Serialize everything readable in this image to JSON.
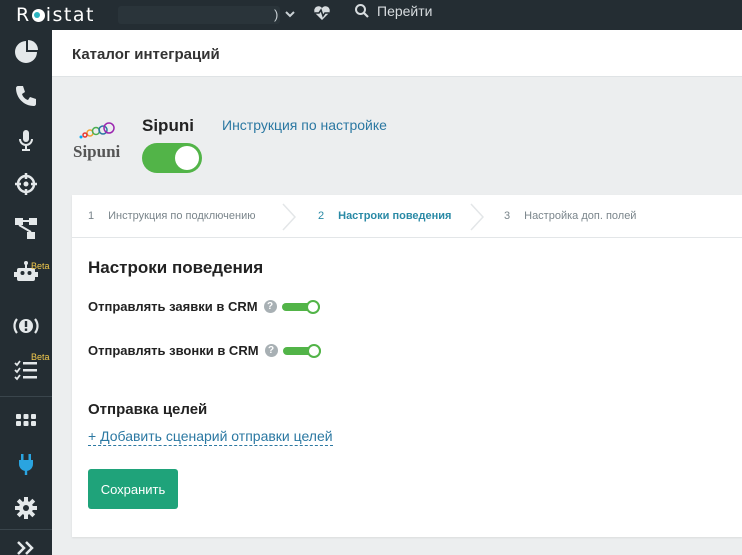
{
  "topbar": {
    "logo": "Roistat",
    "project_name": ")",
    "goto_label": "Перейти"
  },
  "sidebar": {
    "items": [
      {
        "name": "analytics",
        "icon": "pie-chart-icon"
      },
      {
        "name": "calltracking",
        "icon": "phone-icon"
      },
      {
        "name": "speech",
        "icon": "microphone-icon"
      },
      {
        "name": "targeting",
        "icon": "crosshair-icon"
      },
      {
        "name": "leads",
        "icon": "flow-icon"
      },
      {
        "name": "bot",
        "icon": "robot-icon",
        "badge": "Beta"
      },
      {
        "name": "alerts",
        "icon": "alert-icon"
      },
      {
        "name": "tasks",
        "icon": "checklist-icon",
        "badge": "Beta"
      },
      {
        "name": "apps",
        "icon": "grid-icon"
      },
      {
        "name": "integrations",
        "icon": "plug-icon"
      },
      {
        "name": "settings",
        "icon": "gear-icon"
      },
      {
        "name": "expand",
        "icon": "double-chevron-icon"
      }
    ]
  },
  "page": {
    "title": "Каталог интеграций"
  },
  "integration": {
    "name": "Sipuni",
    "logo_text": "Sipuni",
    "enabled": true,
    "instruction_link": "Инструкция по настройке"
  },
  "steps": [
    {
      "num": "1",
      "label": "Инструкция по подключению",
      "active": false
    },
    {
      "num": "2",
      "label": "Настроки поведения",
      "active": true
    },
    {
      "num": "3",
      "label": "Настройка доп. полей",
      "active": false
    }
  ],
  "settings": {
    "section_title": "Настроки поведения",
    "options": [
      {
        "label": "Отправлять заявки в CRM",
        "enabled": true
      },
      {
        "label": "Отправлять звонки в CRM",
        "enabled": true
      }
    ],
    "help_glyph": "?"
  },
  "goals": {
    "title": "Отправка целей",
    "add_link": "+ Добавить сценарий отправки целей"
  },
  "actions": {
    "save_label": "Сохранить"
  },
  "colors": {
    "sidebar_bg": "#242d33",
    "accent_link": "#2b78a2",
    "toggle_on": "#52b448",
    "save_button": "#1fa37a",
    "active_step": "#2a8aa6",
    "active_nav_icon": "#2aa4e0"
  }
}
